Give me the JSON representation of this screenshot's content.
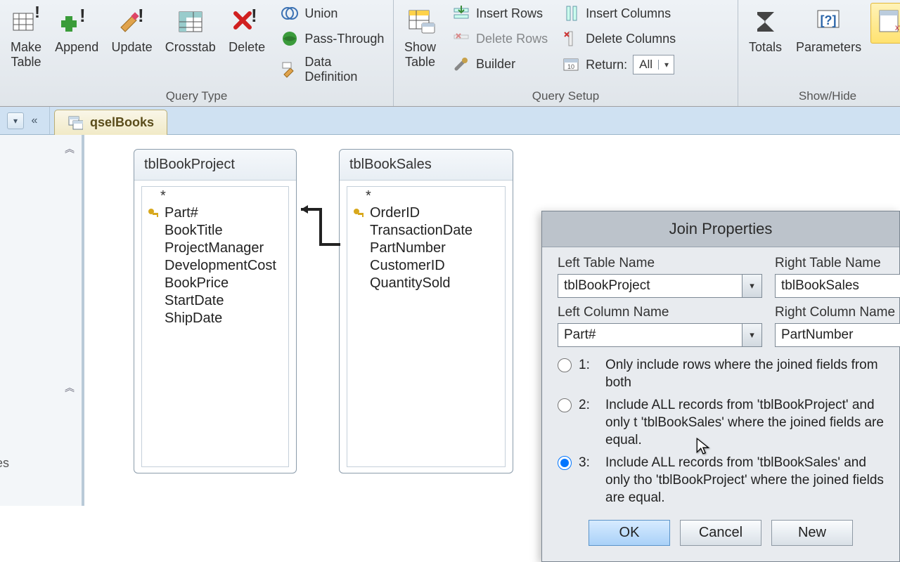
{
  "ribbon": {
    "queryType": {
      "label": "Query Type",
      "makeTable": "Make\nTable",
      "append": "Append",
      "update": "Update",
      "crosstab": "Crosstab",
      "delete": "Delete",
      "union": "Union",
      "passThrough": "Pass-Through",
      "dataDefinition": "Data Definition"
    },
    "querySetup": {
      "label": "Query Setup",
      "showTable": "Show\nTable",
      "insertRows": "Insert Rows",
      "deleteRows": "Delete Rows",
      "builder": "Builder",
      "insertColumns": "Insert Columns",
      "deleteColumns": "Delete Columns",
      "returnLabel": "Return:",
      "returnValue": "All"
    },
    "showHide": {
      "label": "Show/Hide",
      "totals": "Totals",
      "parameters": "Parameters"
    }
  },
  "tab": {
    "name": "qselBooks"
  },
  "tables": {
    "left": {
      "title": "tblBookProject",
      "pk": "Part#",
      "fields": [
        "BookTitle",
        "ProjectManager",
        "DevelopmentCost",
        "BookPrice",
        "StartDate",
        "ShipDate"
      ]
    },
    "right": {
      "title": "tblBookSales",
      "pk": "OrderID",
      "fields": [
        "TransactionDate",
        "PartNumber",
        "CustomerID",
        "QuantitySold"
      ]
    }
  },
  "dialog": {
    "title": "Join Properties",
    "leftTableLabel": "Left Table Name",
    "rightTableLabel": "Right Table Name",
    "leftTableValue": "tblBookProject",
    "rightTableValue": "tblBookSales",
    "leftColLabel": "Left Column Name",
    "rightColLabel": "Right Column Name",
    "leftColValue": "Part#",
    "rightColValue": "PartNumber",
    "opt1num": "1:",
    "opt1": "Only include rows where the joined fields from both",
    "opt2num": "2:",
    "opt2": "Include ALL records from 'tblBookProject' and only t 'tblBookSales' where the joined fields are equal.",
    "opt3num": "3:",
    "opt3": "Include ALL records from 'tblBookSales' and only tho 'tblBookProject' where the joined fields are equal.",
    "ok": "OK",
    "cancel": "Cancel",
    "new": "New"
  },
  "nav": {
    "itemText": "es"
  }
}
